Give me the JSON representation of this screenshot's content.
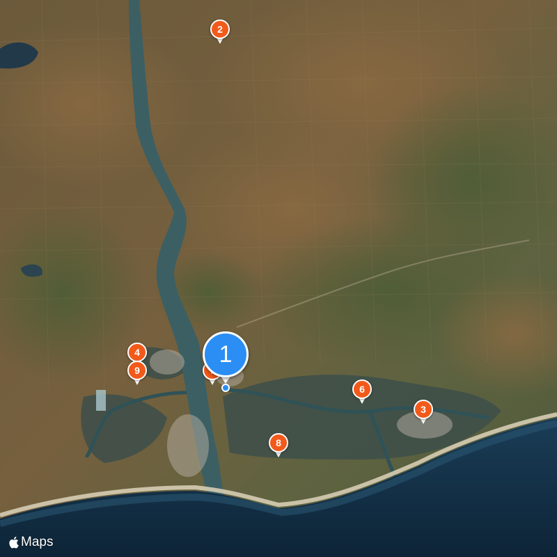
{
  "map": {
    "kind": "satellite",
    "colors": {
      "land": "#6a5d3f",
      "river": "#3c5f63",
      "ocean": "#0f2c43",
      "beach": "#d6cdb4",
      "marker": "#f25a1b",
      "selected_marker": "#2b8ef5"
    }
  },
  "selected_marker": {
    "label": "1"
  },
  "markers": [
    {
      "label": "2"
    },
    {
      "label": "3"
    },
    {
      "label": "4"
    },
    {
      "label": "6"
    },
    {
      "label": "7"
    },
    {
      "label": "8"
    },
    {
      "label": "9"
    }
  ],
  "attribution": {
    "text": "Maps",
    "icon": "apple-logo-icon"
  }
}
